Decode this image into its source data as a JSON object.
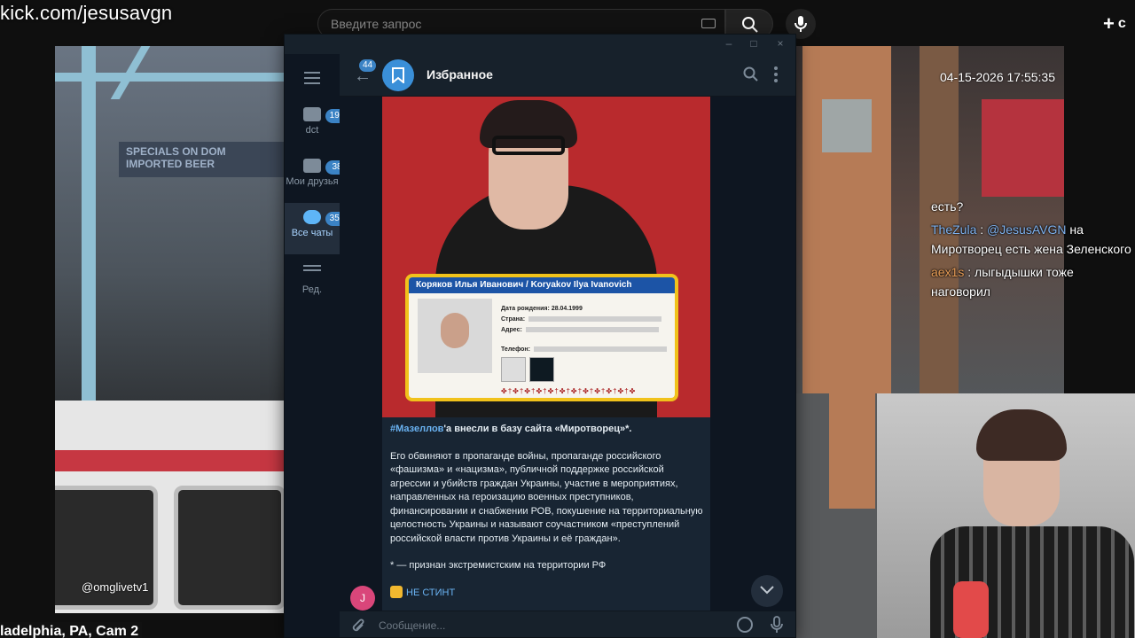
{
  "overlay": {
    "url": "kick.com/jesusavgn",
    "cam_credit": "@omglivetv1",
    "cam_caption": "ladelphia, PA, Cam 2",
    "timestamp": "04-15-2026 17:55:35",
    "shop_sign": "SPECIALS ON DOM IMPORTED BEER"
  },
  "browser": {
    "search_placeholder": "Введите запрос",
    "create_label": "+",
    "create_letter": "с"
  },
  "chat": [
    {
      "user": "",
      "text": "есть?"
    },
    {
      "user": "TheZula",
      "mention": "@JesusAVGN",
      "text": "на Миротворец есть жена Зеленского"
    },
    {
      "user": "aex1s",
      "text": "лыгыдышки тоже наговорил"
    }
  ],
  "telegram": {
    "window_controls": [
      "–",
      "□",
      "×"
    ],
    "folders": [
      {
        "label": "dct",
        "badge": "193"
      },
      {
        "label": "Мои друзья",
        "badge": "38"
      },
      {
        "label": "Все чаты",
        "badge": "352"
      },
      {
        "label": "Ред."
      }
    ],
    "header": {
      "back_badge": "44",
      "title": "Избранное"
    },
    "id_card": {
      "title": "Коряков Илья Иванович / Koryakov Ilya Ivanovich",
      "dob_label": "Дата рождения:",
      "dob": "28.04.1999",
      "country_label": "Страна:",
      "address_label": "Адрес:",
      "phone_label": "Телефон:",
      "chain": "✤†✤†✤†✤†✤†✤†✤†✤†✤†✤†✤†✤"
    },
    "message": {
      "hashtag": "#Мазеллов",
      "headline_rest": "'а внесли в базу сайта «Миротворец»*.",
      "body": "Его обвиняют в пропаганде войны, пропаганде российского «фашизма» и «нацизма», публичной поддержке российской агрессии и убийств граждан Украины, участие в мероприятиях, направленных на героизацию военных преступников, финансировании и снабжении РОВ, покушение на территориальную целостность Украины и называют соучастником «преступлений российской власти против Украины и её граждан».",
      "footnote": "* — признан экстремистским на территории РФ",
      "link": "НЕ СТИНТ",
      "sender_initial": "J"
    },
    "composer": {
      "placeholder": "Сообщение..."
    }
  }
}
